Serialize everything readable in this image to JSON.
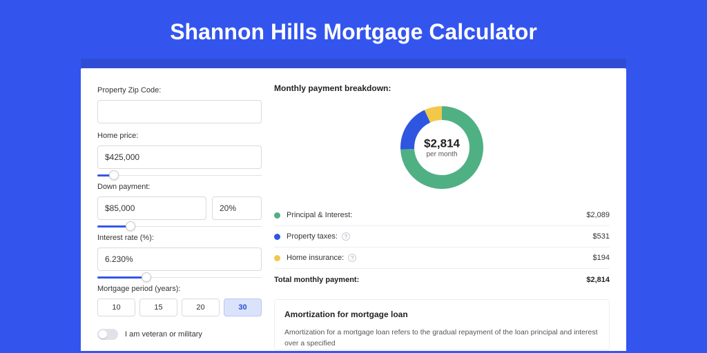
{
  "title": "Shannon Hills Mortgage Calculator",
  "form": {
    "zip_label": "Property Zip Code:",
    "zip_value": "",
    "home_price_label": "Home price:",
    "home_price_value": "$425,000",
    "home_price_slider_pct": 10,
    "down_payment_label": "Down payment:",
    "down_payment_amount": "$85,000",
    "down_payment_pct": "20%",
    "down_payment_slider_pct": 20,
    "interest_label": "Interest rate (%):",
    "interest_value": "6.230%",
    "interest_slider_pct": 30,
    "period_label": "Mortgage period (years):",
    "periods": [
      "10",
      "15",
      "20",
      "30"
    ],
    "period_selected_index": 3,
    "veteran_label": "I am veteran or military",
    "veteran_on": false
  },
  "breakdown": {
    "title": "Monthly payment breakdown:",
    "center_amount": "$2,814",
    "center_sub": "per month",
    "items": [
      {
        "label": "Principal & Interest:",
        "value": "$2,089",
        "color": "#4fb084",
        "info": false
      },
      {
        "label": "Property taxes:",
        "value": "$531",
        "color": "#2f56e0",
        "info": true
      },
      {
        "label": "Home insurance:",
        "value": "$194",
        "color": "#f2c84b",
        "info": true
      }
    ],
    "total_label": "Total monthly payment:",
    "total_value": "$2,814"
  },
  "chart_data": {
    "type": "pie",
    "title": "Monthly payment breakdown",
    "series": [
      {
        "name": "Principal & Interest",
        "value": 2089,
        "color": "#4fb084"
      },
      {
        "name": "Property taxes",
        "value": 531,
        "color": "#2f56e0"
      },
      {
        "name": "Home insurance",
        "value": 194,
        "color": "#f2c84b"
      }
    ],
    "total": 2814,
    "unit": "USD per month"
  },
  "amort": {
    "title": "Amortization for mortgage loan",
    "text": "Amortization for a mortgage loan refers to the gradual repayment of the loan principal and interest over a specified"
  }
}
